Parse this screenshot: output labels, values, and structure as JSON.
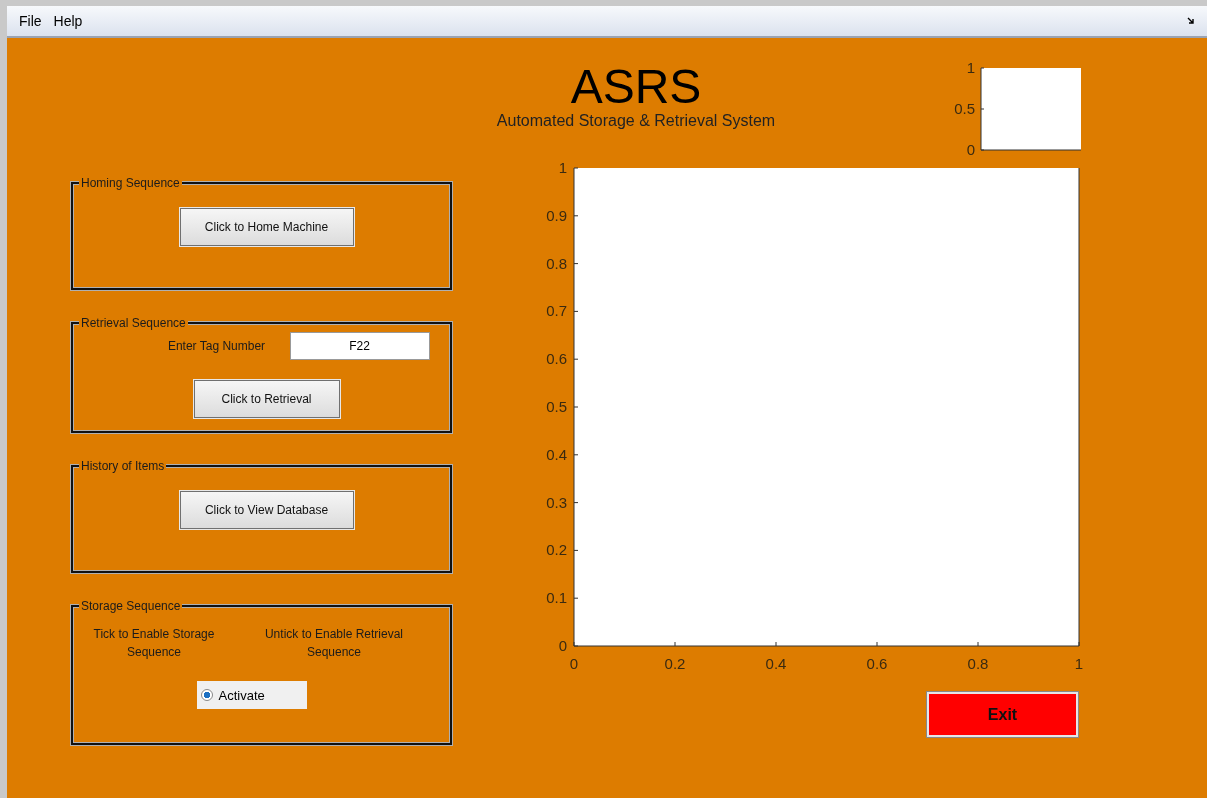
{
  "menu": [
    {
      "label": "File"
    },
    {
      "label": "Help"
    }
  ],
  "title": "ASRS",
  "subtitle": "Automated Storage & Retrieval System",
  "panels": [
    {
      "kind": "button",
      "title": "Homing Sequence",
      "button": "Click to Home Machine"
    },
    {
      "kind": "entry",
      "title": "Retrieval Sequence",
      "field_label": "Enter Tag Number",
      "field_value": "F22",
      "button": "Click to Retrieval"
    },
    {
      "kind": "button",
      "title": "History of Items",
      "button": "Click to View Database"
    },
    {
      "kind": "toggle",
      "title": "Storage Sequence",
      "hints": [
        "Tick to Enable Storage Sequence",
        "Untick to Enable Retrieval Sequence"
      ],
      "option": {
        "label": "Activate",
        "checked": true
      }
    }
  ],
  "small_axes": {
    "tick_labels": [
      "1",
      "0.5",
      "0"
    ]
  },
  "main_axes": {
    "chart_data": {
      "type": "line",
      "xlim": [
        0,
        1
      ],
      "ylim": [
        0,
        1
      ],
      "xticks": [
        {
          "value": 0,
          "label": "0"
        },
        {
          "value": 0.2,
          "label": "0.2"
        },
        {
          "value": 0.4,
          "label": "0.4"
        },
        {
          "value": 0.6,
          "label": "0.6"
        },
        {
          "value": 0.8,
          "label": "0.8"
        },
        {
          "value": 1,
          "label": "1"
        }
      ],
      "yticks": [
        {
          "value": 0,
          "label": "0"
        },
        {
          "value": 0.1,
          "label": "0.1"
        },
        {
          "value": 0.2,
          "label": "0.2"
        },
        {
          "value": 0.3,
          "label": "0.3"
        },
        {
          "value": 0.4,
          "label": "0.4"
        },
        {
          "value": 0.5,
          "label": "0.5"
        },
        {
          "value": 0.6,
          "label": "0.6"
        },
        {
          "value": 0.7,
          "label": "0.7"
        },
        {
          "value": 0.8,
          "label": "0.8"
        },
        {
          "value": 0.9,
          "label": "0.9"
        },
        {
          "value": 1,
          "label": "1"
        }
      ]
    }
  },
  "exit_button": "Exit"
}
